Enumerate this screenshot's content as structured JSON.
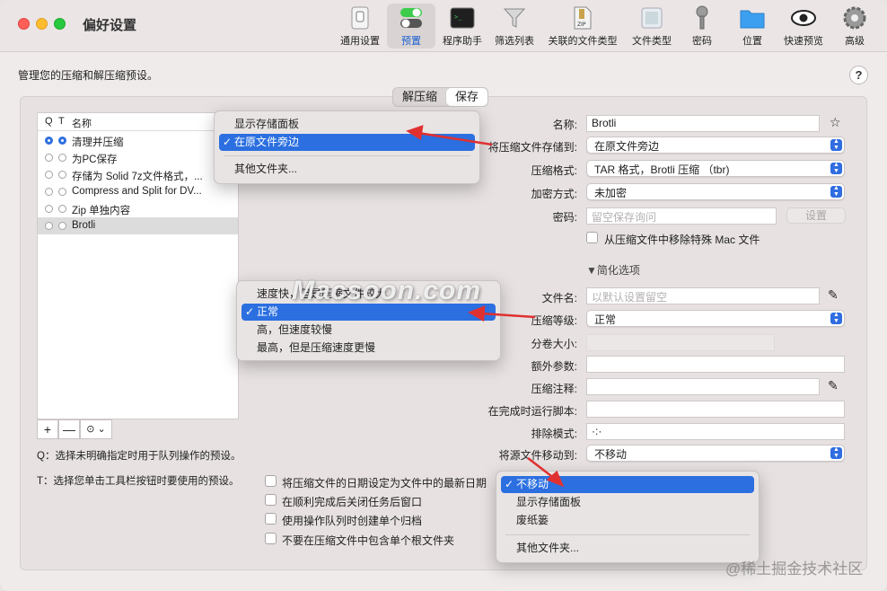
{
  "window": {
    "title": "偏好设置"
  },
  "toolbar": [
    {
      "label": "通用设置",
      "icon": "switch-icon"
    },
    {
      "label": "预置",
      "icon": "toggle-icon",
      "active": true
    },
    {
      "label": "程序助手",
      "icon": "terminal-icon"
    },
    {
      "label": "筛选列表",
      "icon": "funnel-icon"
    },
    {
      "label": "关联的文件类型",
      "icon": "zip-file-icon"
    },
    {
      "label": "文件类型",
      "icon": "file-type-icon"
    },
    {
      "label": "密码",
      "icon": "key-icon"
    },
    {
      "label": "位置",
      "icon": "folder-icon"
    },
    {
      "label": "快速预览",
      "icon": "eye-icon"
    },
    {
      "label": "高级",
      "icon": "gear-icon"
    }
  ],
  "description": "管理您的压缩和解压缩预设。",
  "help": "?",
  "tabs": [
    {
      "label": "解压缩"
    },
    {
      "label": "保存",
      "selected": true
    }
  ],
  "list": {
    "headers": {
      "q": "Q",
      "t": "T",
      "name": "名称"
    },
    "rows": [
      {
        "name": "清理并压缩",
        "q": true,
        "t": true
      },
      {
        "name": "为PC保存",
        "q": false,
        "t": false
      },
      {
        "name": "存储为 Solid 7z文件格式，...",
        "q": false,
        "t": false
      },
      {
        "name": "Compress and Split for DV...",
        "q": false,
        "t": false
      },
      {
        "name": "Zip 单独内容",
        "q": false,
        "t": false
      },
      {
        "name": "Brotli",
        "q": false,
        "t": false,
        "selected": true
      }
    ],
    "buttons": {
      "add": "+",
      "remove": "—",
      "more": "⊙ ⌄"
    }
  },
  "notes": {
    "q": "Q：选择未明确指定时用于队列操作的预设。",
    "t": "T：选择您单击工具栏按钮时要使用的预设。"
  },
  "form": {
    "name_label": "名称:",
    "name_value": "Brotli",
    "store_label": "将压缩文件存储到:",
    "store_value": "在原文件旁边",
    "format_label": "压缩格式:",
    "format_value": "TAR 格式，Brotli 压缩 （tbr)",
    "encrypt_label": "加密方式:",
    "encrypt_value": "未加密",
    "password_label": "密码:",
    "password_placeholder": "留空保存询问",
    "password_button": "设置",
    "remove_mac_files": "从压缩文件中移除特殊 Mac 文件",
    "simplify": "▼简化选项",
    "filename_label": "文件名:",
    "filename_placeholder": "以默认设置留空",
    "level_label": "压缩等级:",
    "level_value": "正常",
    "volume_label": "分卷大小:",
    "extra_label": "额外参数:",
    "comment_label": "压缩注释:",
    "script_label": "在完成时运行脚本:",
    "exclude_label": "排除模式:",
    "exclude_value": "·:·",
    "move_label": "将源文件移动到:",
    "move_value": "不移动"
  },
  "checkboxes": [
    "将压缩文件的日期设定为文件中的最新日期",
    "在顺利完成后关闭任务后窗口",
    "使用操作队列时创建单个归档",
    "不要在压缩文件中包含单个根文件夹"
  ],
  "menu_store": {
    "items": [
      "显示存储面板",
      "在原文件旁边",
      "其他文件夹..."
    ],
    "checked": 1
  },
  "menu_level": {
    "items": [
      "速度快，但是压缩文件较大",
      "正常",
      "高，但速度较慢",
      "最高，但是压缩速度更慢"
    ],
    "checked": 1
  },
  "menu_move": {
    "items": [
      "不移动",
      "显示存储面板",
      "废纸篓",
      "其他文件夹..."
    ],
    "checked": 0
  },
  "watermark": "Macsoon.com",
  "footer": "@稀土掘金技术社区",
  "colors": {
    "accent": "#2b6fe0",
    "arrow": "#e03030"
  }
}
